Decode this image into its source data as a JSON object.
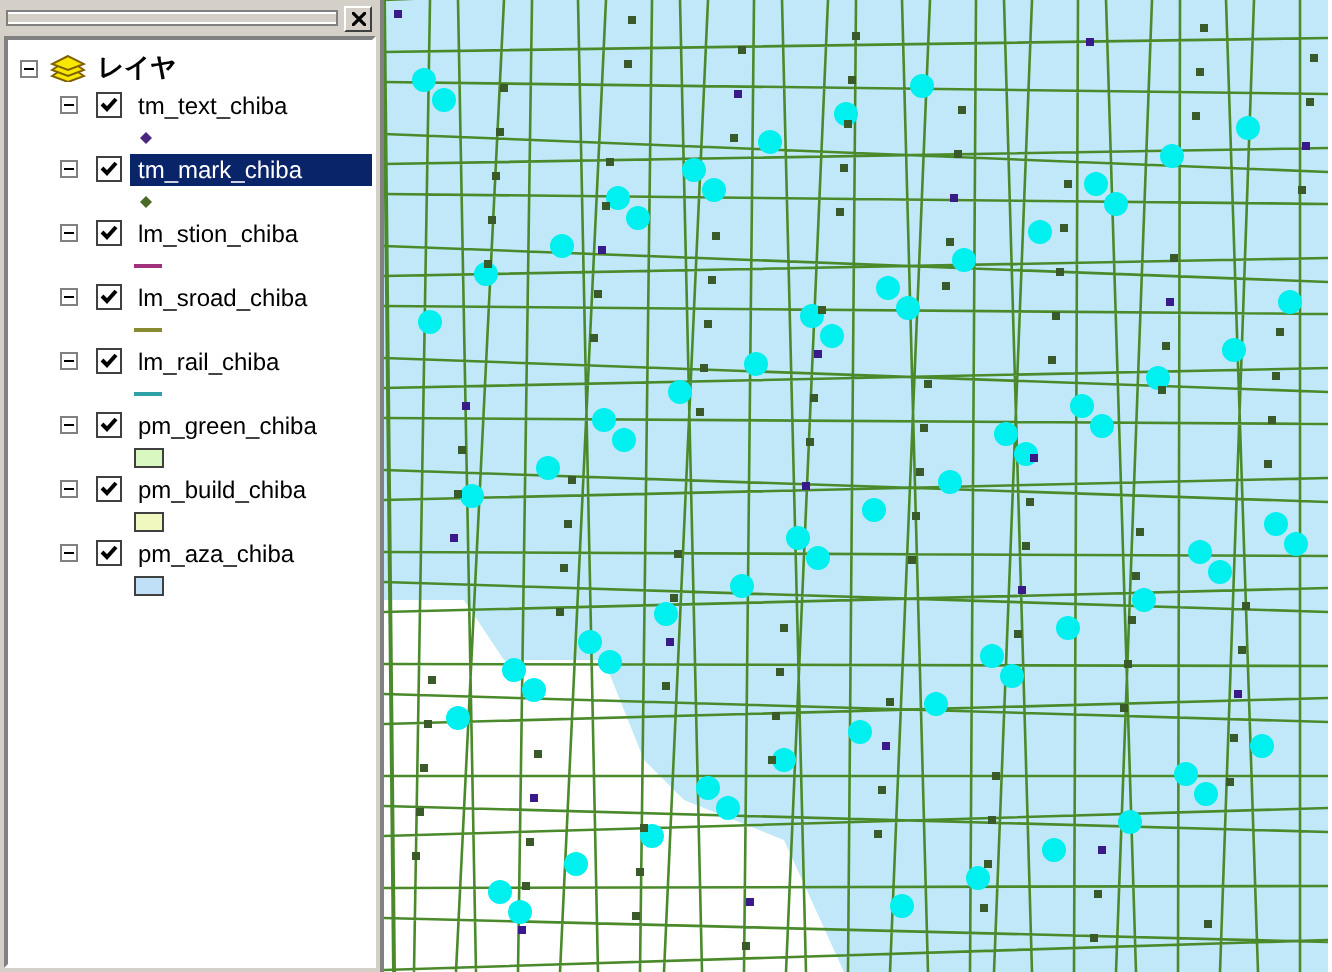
{
  "tree": {
    "title": "レイヤ",
    "expanded": true,
    "layers": [
      {
        "name": "tm_text_chiba",
        "checked": true,
        "expanded": true,
        "selected": false,
        "symbol": {
          "kind": "point",
          "color": "#4b2680"
        }
      },
      {
        "name": "tm_mark_chiba",
        "checked": true,
        "expanded": true,
        "selected": true,
        "symbol": {
          "kind": "point",
          "color": "#4a6a2a"
        }
      },
      {
        "name": "lm_stion_chiba",
        "checked": true,
        "expanded": true,
        "selected": false,
        "symbol": {
          "kind": "line",
          "color": "#a0307a"
        }
      },
      {
        "name": "lm_sroad_chiba",
        "checked": true,
        "expanded": true,
        "selected": false,
        "symbol": {
          "kind": "line",
          "color": "#8a8a30"
        }
      },
      {
        "name": "lm_rail_chiba",
        "checked": true,
        "expanded": true,
        "selected": false,
        "symbol": {
          "kind": "line",
          "color": "#30a0a8"
        }
      },
      {
        "name": "pm_green_chiba",
        "checked": true,
        "expanded": true,
        "selected": false,
        "symbol": {
          "kind": "polygon",
          "color": "#d8f8c0"
        }
      },
      {
        "name": "pm_build_chiba",
        "checked": true,
        "expanded": true,
        "selected": false,
        "symbol": {
          "kind": "polygon",
          "color": "#f0f8c0"
        }
      },
      {
        "name": "pm_aza_chiba",
        "checked": true,
        "expanded": true,
        "selected": false,
        "symbol": {
          "kind": "polygon",
          "color": "#c0e0f8"
        }
      }
    ]
  }
}
